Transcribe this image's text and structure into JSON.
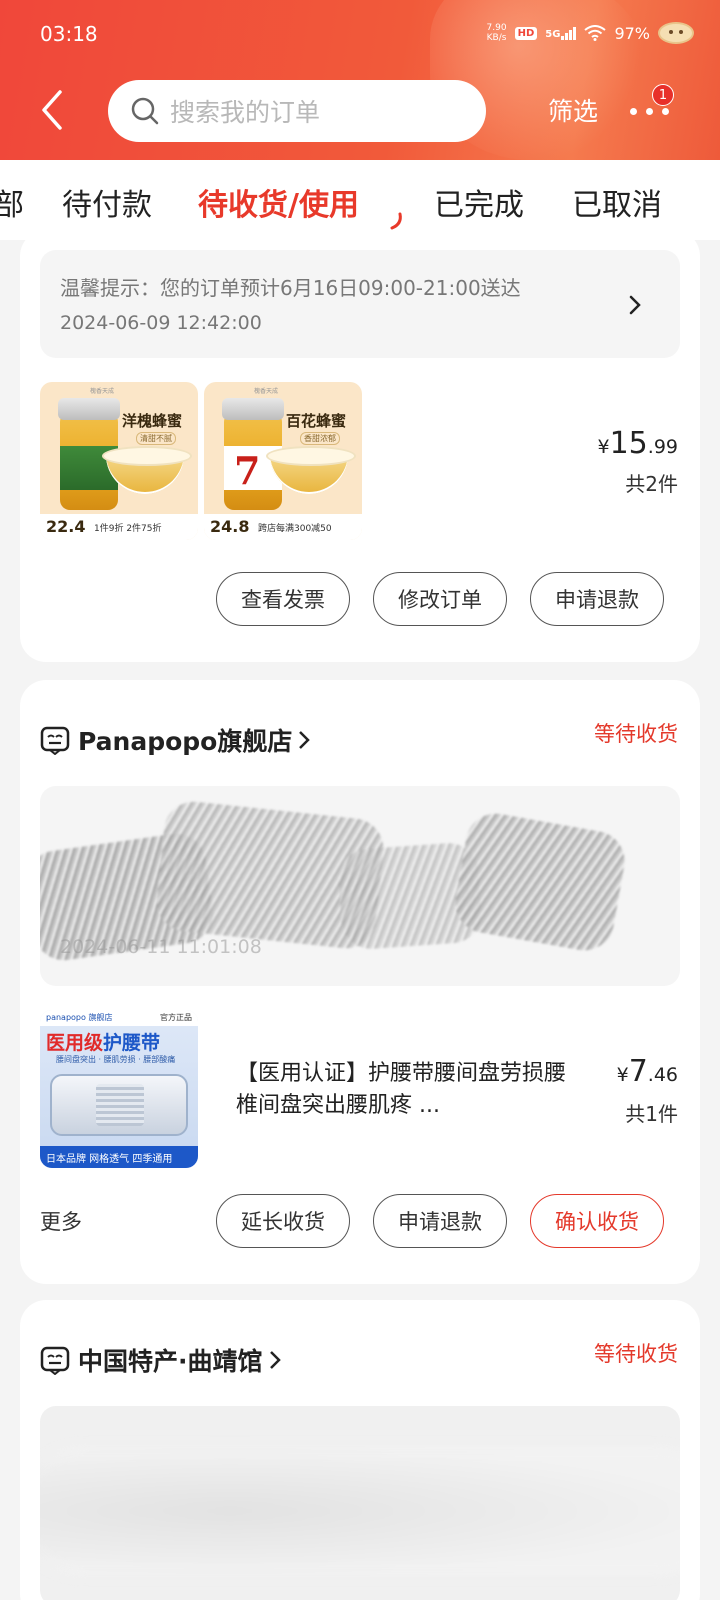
{
  "status_bar": {
    "time": "03:18",
    "net_speed_top": "7.90",
    "net_speed_unit": "KB/s",
    "hd": "HD",
    "network": "5G",
    "battery": "97%"
  },
  "header": {
    "search_placeholder": "搜索我的订单",
    "filter_label": "筛选",
    "more_badge": "1"
  },
  "tabs": [
    {
      "label": "部"
    },
    {
      "label": "待付款"
    },
    {
      "label": "待收货/使用",
      "active": true
    },
    {
      "label": "已完成"
    },
    {
      "label": "已取消"
    }
  ],
  "order1": {
    "notice_line1": "温馨提示：您的订单预计6月16日09:00-21:00送达",
    "notice_line2": "2024-06-09 12:42:00",
    "products": [
      {
        "name": "洋槐蜂蜜",
        "sub": "清甜不腻",
        "price_tag": "22.4",
        "promo": "1件9折 2件75折"
      },
      {
        "name": "百花蜂蜜",
        "sub": "香甜浓郁",
        "price_tag": "24.8",
        "promo": "跨店每满300减50"
      }
    ],
    "price_symbol": "¥",
    "price_int": "15",
    "price_dec": ".99",
    "quantity": "共2件",
    "buttons": [
      "查看发票",
      "修改订单",
      "申请退款"
    ]
  },
  "order2": {
    "store_name": "Panapopo旗舰店",
    "status": "等待收货",
    "notice_timestamp": "2024-06-11 11:01:08",
    "product_brand": "panapopo 旗舰店",
    "product_badge": "官方正品",
    "product_banner_red": "医用级",
    "product_banner_blue": "护腰带",
    "product_tags": "腰间盘突出 · 腰肌劳损 · 腰部酸痛",
    "product_footer": "日本品牌  网格透气  四季通用",
    "product_title": "【医用认证】护腰带腰间盘劳损腰椎间盘突出腰肌疼 ...",
    "price_symbol": "¥",
    "price_int": "7",
    "price_dec": ".46",
    "quantity": "共1件",
    "more_label": "更多",
    "buttons": [
      "延长收货",
      "申请退款",
      "确认收货"
    ]
  },
  "order3": {
    "store_name": "中国特产·曲靖馆",
    "status": "等待收货"
  },
  "colors": {
    "accent": "#e8392a",
    "header_start": "#f0473a",
    "header_end": "#f57a4e"
  }
}
